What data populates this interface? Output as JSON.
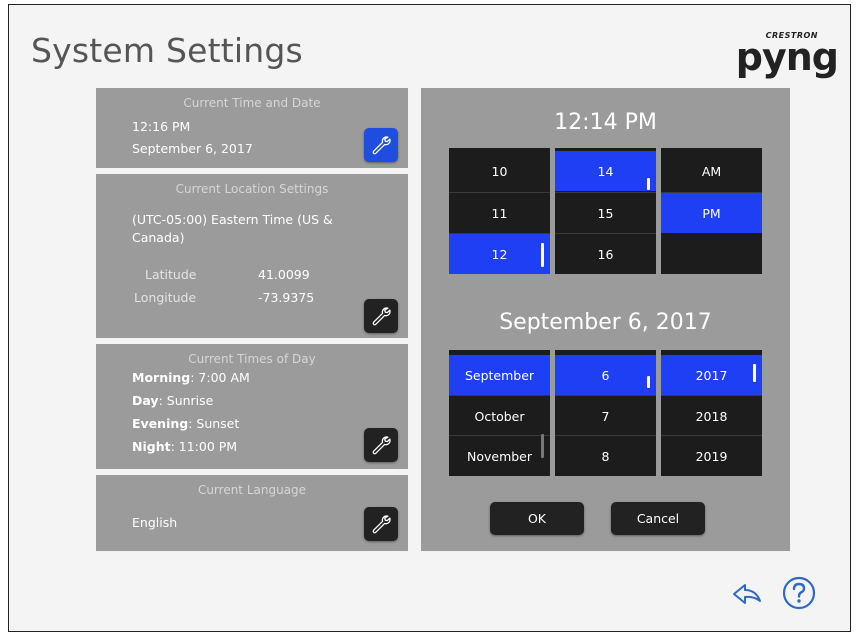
{
  "page": {
    "title": "System Settings"
  },
  "brand": {
    "maker": "CRESTRON",
    "name": "pyng"
  },
  "time_date_panel": {
    "title": "Current Time and Date",
    "time": "12:16 PM",
    "date": "September 6, 2017"
  },
  "location_panel": {
    "title": "Current Location Settings",
    "timezone_line1": "(UTC-05:00) Eastern Time (US &",
    "timezone_line2": "Canada)",
    "latitude_label": "Latitude",
    "latitude_value": "41.0099",
    "longitude_label": "Longitude",
    "longitude_value": "-73.9375"
  },
  "times_of_day_panel": {
    "title": "Current Times of Day",
    "morning_label": "Morning",
    "morning_value": ": 7:00 AM",
    "day_label": "Day",
    "day_value": ": Sunrise",
    "evening_label": "Evening",
    "evening_value": ": Sunset",
    "night_label": "Night",
    "night_value": ": 11:00 PM"
  },
  "language_panel": {
    "title": "Current Language",
    "value": "English"
  },
  "picker": {
    "time_label": "12:14 PM",
    "date_label": "September 6, 2017",
    "hours": [
      "10",
      "11",
      "12"
    ],
    "selected_hour": "12",
    "minutes": [
      "14",
      "15",
      "16"
    ],
    "selected_minute": "14",
    "ampm": [
      "AM",
      "PM"
    ],
    "selected_ampm": "PM",
    "months": [
      "September",
      "October",
      "November"
    ],
    "selected_month": "September",
    "days": [
      "6",
      "7",
      "8"
    ],
    "selected_day": "6",
    "years": [
      "2017",
      "2018",
      "2019"
    ],
    "selected_year": "2017",
    "ok_label": "OK",
    "cancel_label": "Cancel"
  },
  "colors": {
    "accent": "#1f3ff5",
    "panel": "#9b9b9b",
    "dark_cell": "#1c1c1c"
  },
  "icons": [
    "wrench-icon",
    "back-arrow-icon",
    "help-icon"
  ]
}
